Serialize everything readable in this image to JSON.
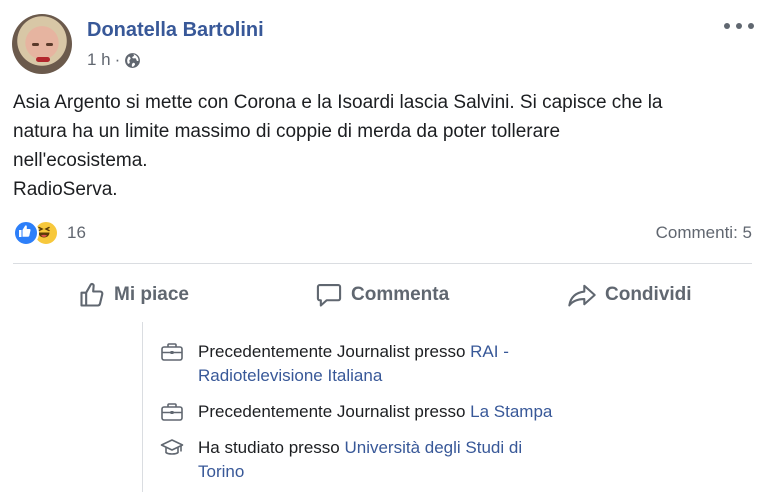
{
  "post": {
    "author": "Donatella Bartolini",
    "time": "1 h",
    "separator": "·",
    "privacy_icon": "globe-icon",
    "lines": [
      "Asia Argento si mette con Corona e la Isoardi lascia Salvini. Si capisce che la",
      "natura ha un limite massimo di coppie di merda da poter tollerare",
      "nell'ecosistema.",
      "RadioServa."
    ],
    "reactions": {
      "icons": [
        "like-reaction-icon",
        "haha-reaction-icon"
      ],
      "count": "16"
    },
    "comments": "Commenti: 5"
  },
  "actions": {
    "like": "Mi piace",
    "comment": "Commenta",
    "share": "Condividi"
  },
  "profile_info": [
    {
      "icon": "briefcase-icon",
      "prefix": "Precedentemente Journalist presso ",
      "link_line1": "RAI -",
      "link_line2": "Radiotelevisione Italiana"
    },
    {
      "icon": "briefcase-icon",
      "prefix": "Precedentemente Journalist presso ",
      "link_line1": "La Stampa",
      "link_line2": ""
    },
    {
      "icon": "graduation-cap-icon",
      "prefix": "Ha studiato presso ",
      "link_line1": "Università degli Studi di",
      "link_line2": "Torino"
    }
  ],
  "colors": {
    "author_blue": "#385898",
    "secondary_text": "#616770",
    "like_blue": "#2d7ff9",
    "haha_yellow": "#f7c83c"
  }
}
